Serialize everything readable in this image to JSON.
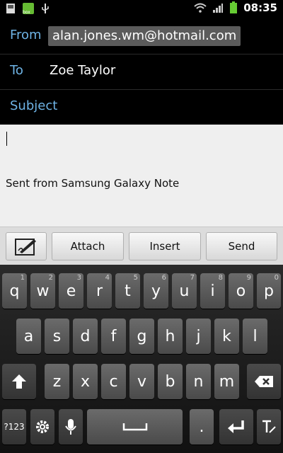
{
  "status": {
    "time": "08:35",
    "notif_text": "box"
  },
  "header": {
    "from_label": "From",
    "from_value": "alan.jones.wm@hotmail.com",
    "to_label": "To",
    "to_value": "Zoe Taylor",
    "subject_label": "Subject"
  },
  "body": {
    "signature": "Sent from Samsung Galaxy Note"
  },
  "toolbar": {
    "attach": "Attach",
    "insert": "Insert",
    "send": "Send"
  },
  "keyboard": {
    "row1": [
      {
        "k": "q",
        "h": "1"
      },
      {
        "k": "w",
        "h": "2"
      },
      {
        "k": "e",
        "h": "3"
      },
      {
        "k": "r",
        "h": "4"
      },
      {
        "k": "t",
        "h": "5"
      },
      {
        "k": "y",
        "h": "6"
      },
      {
        "k": "u",
        "h": "7"
      },
      {
        "k": "i",
        "h": "8"
      },
      {
        "k": "o",
        "h": "9"
      },
      {
        "k": "p",
        "h": "0"
      }
    ],
    "row2": [
      "a",
      "s",
      "d",
      "f",
      "g",
      "h",
      "j",
      "k",
      "l"
    ],
    "row3": [
      "z",
      "x",
      "c",
      "v",
      "b",
      "n",
      "m"
    ],
    "sym_label": "?123",
    "period": "."
  }
}
